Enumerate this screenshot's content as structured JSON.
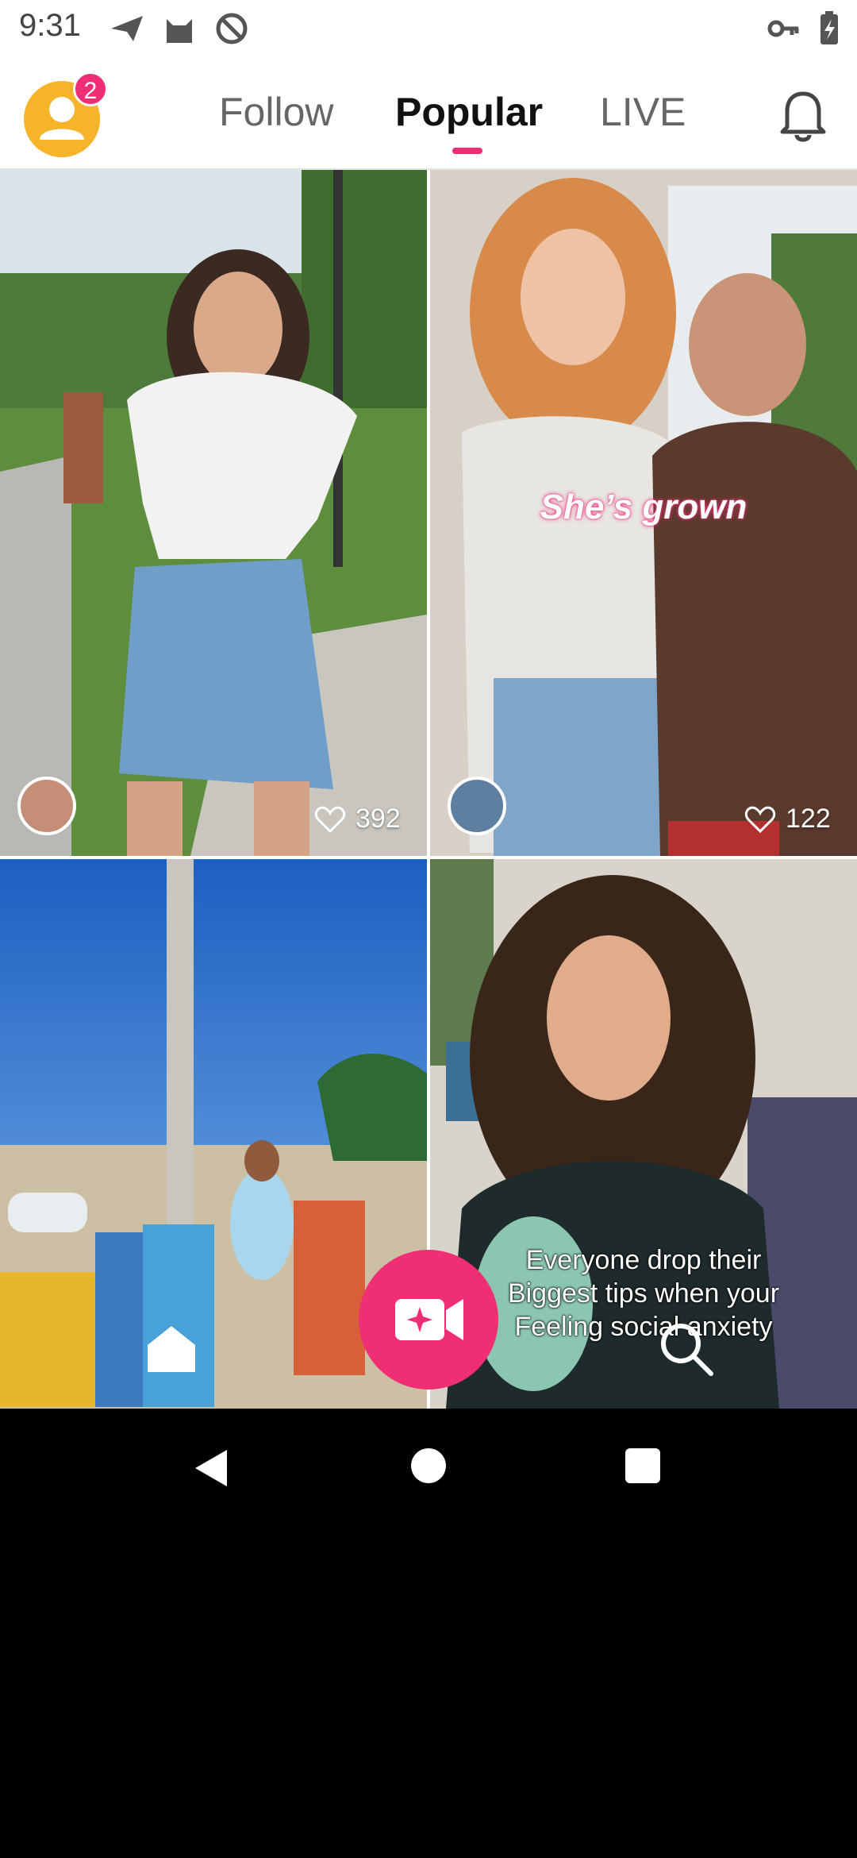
{
  "status_bar": {
    "time": "9:31",
    "icons": [
      "send-icon",
      "cat-icon",
      "at-sign-icon",
      "key-icon",
      "battery-charging-icon"
    ]
  },
  "top_nav": {
    "avatar_badge": "2",
    "tabs": [
      {
        "label": "Follow"
      },
      {
        "label": "Popular"
      },
      {
        "label": "LIVE"
      }
    ],
    "active_tab": "Popular",
    "accent_color": "#ef2e73"
  },
  "feed": [
    {
      "likes": "392",
      "caption": ""
    },
    {
      "likes": "122",
      "caption": "She’s grown"
    },
    {
      "likes": "",
      "caption": ""
    },
    {
      "likes": "",
      "caption_lines": [
        "Everyone drop their",
        "Biggest tips when your",
        "Feeling social anxiety"
      ]
    }
  ],
  "bottom_bar": {
    "icons": [
      "home-icon",
      "record-video-icon",
      "search-icon"
    ]
  },
  "system_nav": {
    "icons": [
      "back-icon",
      "home-circle-icon",
      "recents-icon"
    ]
  }
}
